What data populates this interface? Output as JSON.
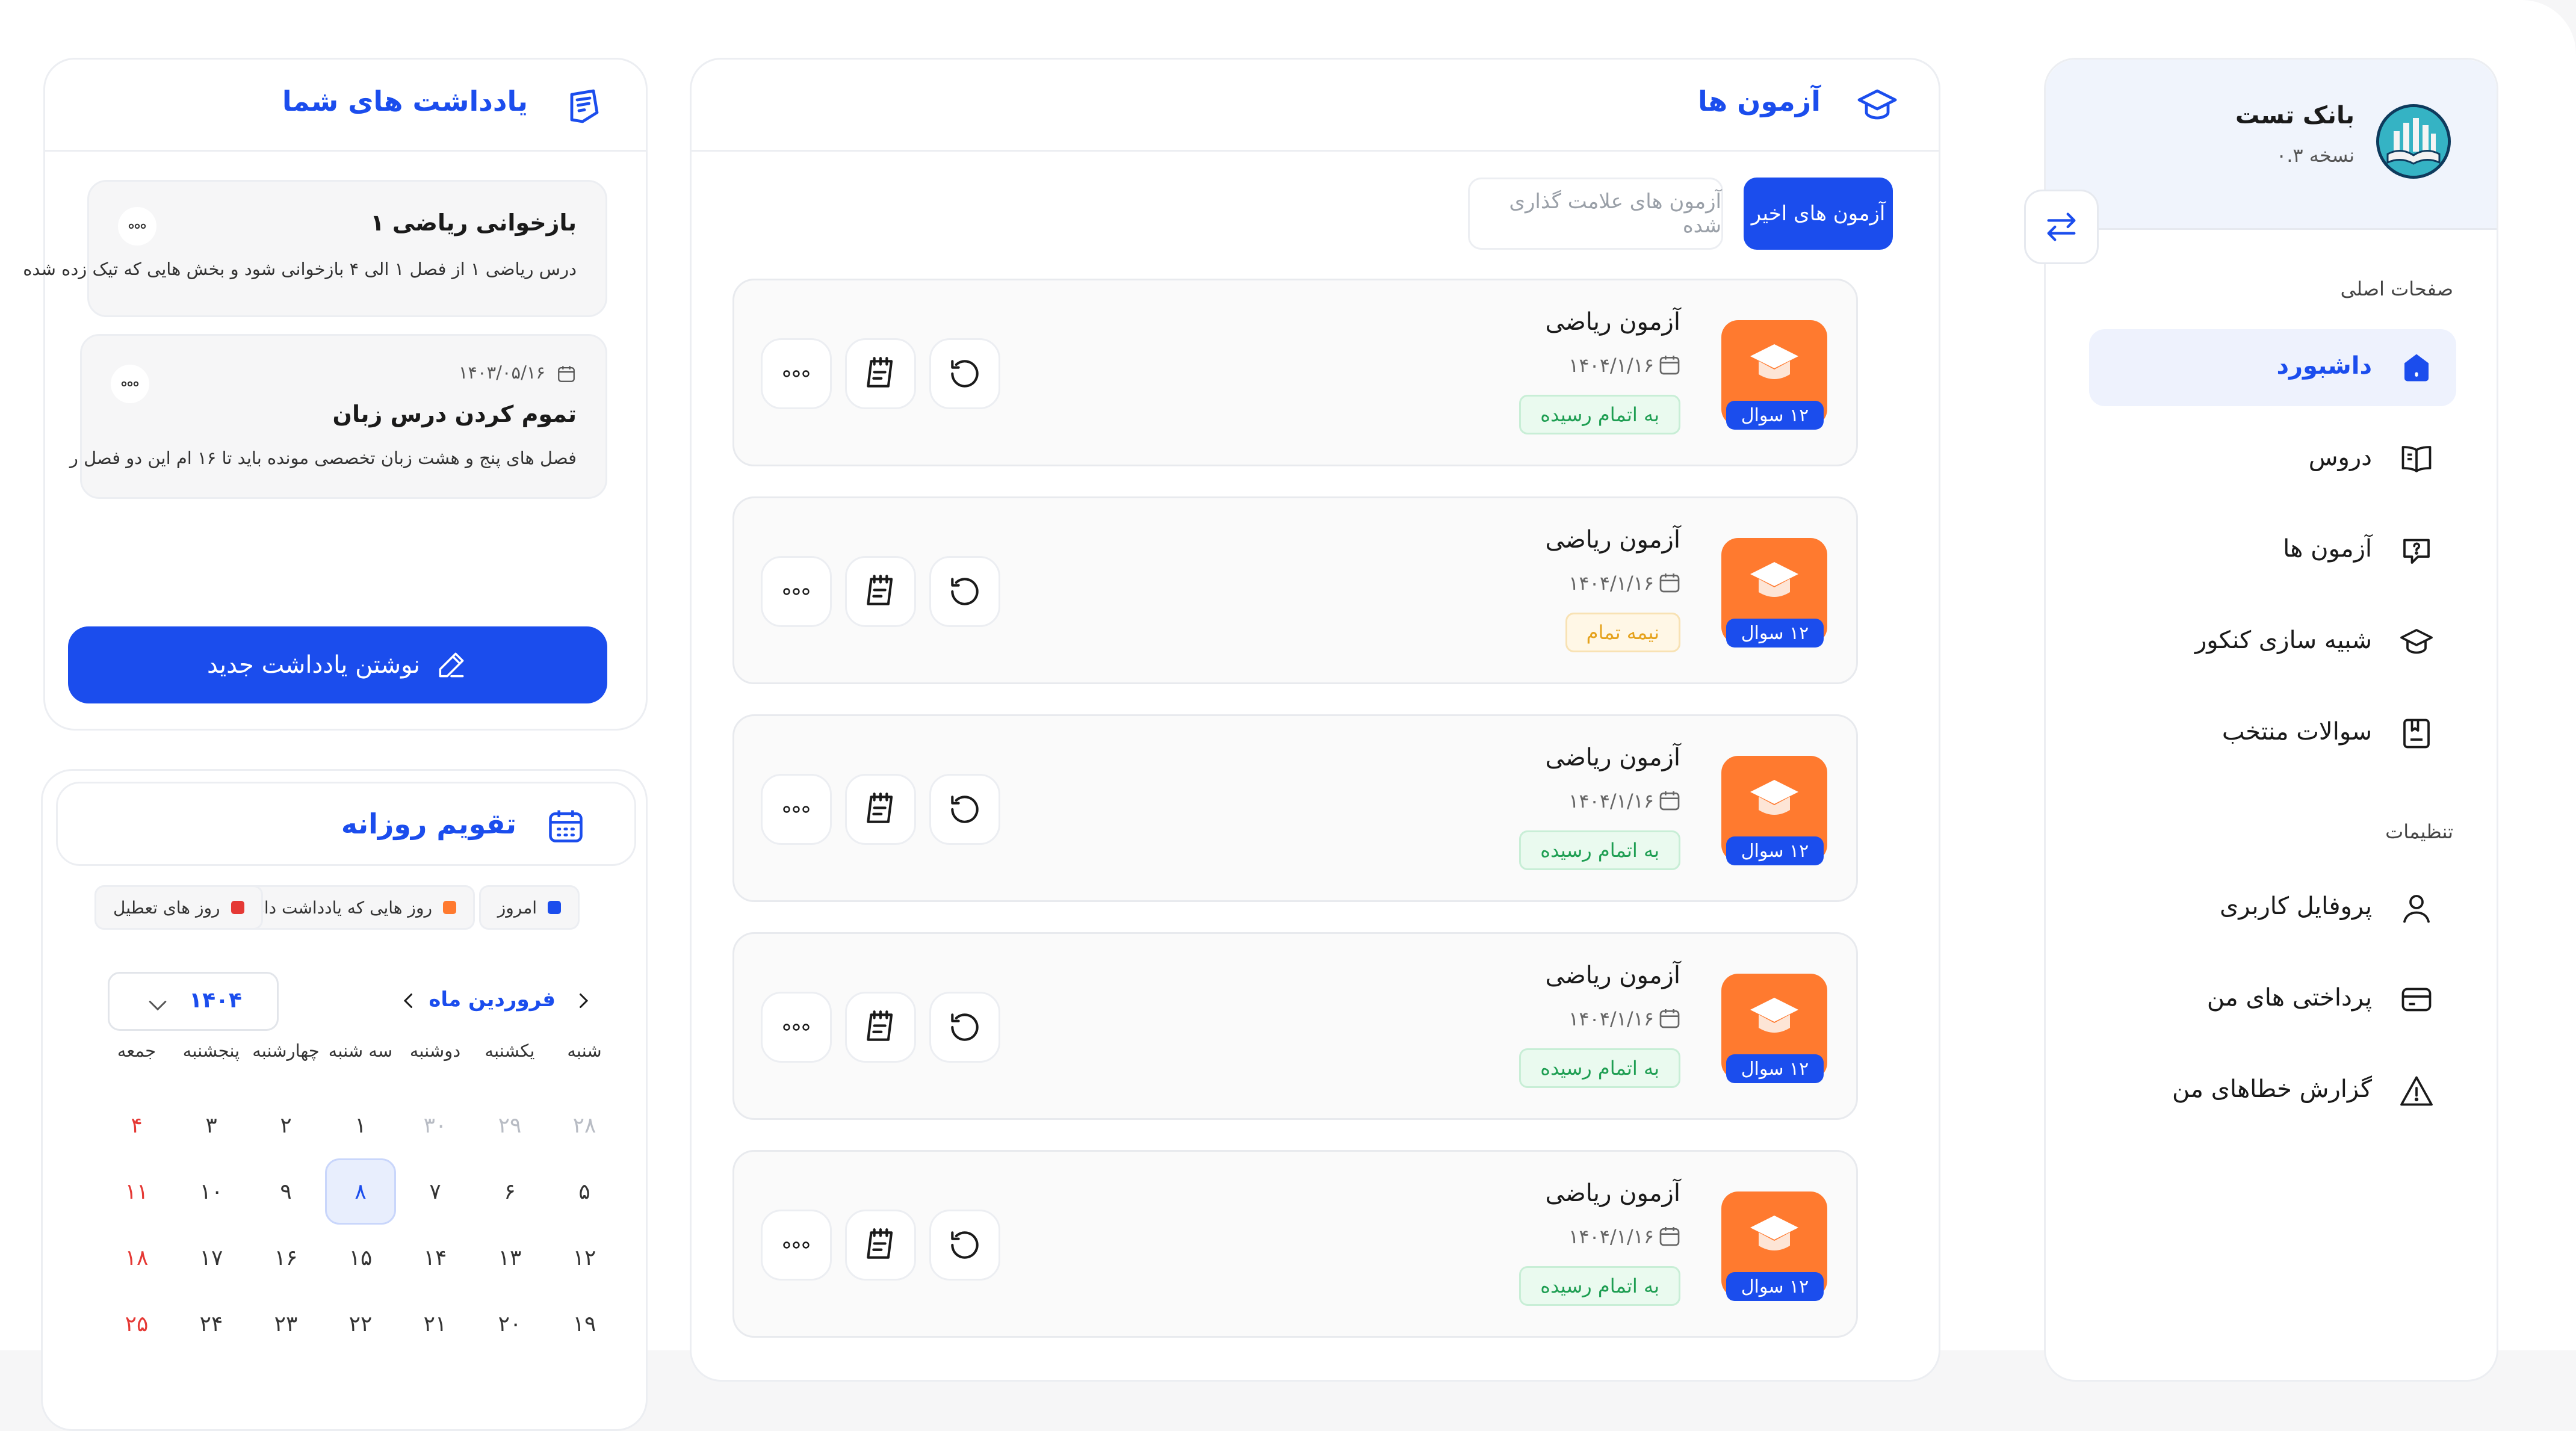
{
  "app": {
    "title": "بانک تست",
    "version": "نسخه ۰.۳"
  },
  "sidebar": {
    "section_main": "صفحات اصلی",
    "section_settings": "تنظیمات",
    "items": [
      {
        "label": "داشبورد",
        "icon": "home-icon"
      },
      {
        "label": "دروس",
        "icon": "book-icon"
      },
      {
        "label": "آزمون ها",
        "icon": "question-chat-icon"
      },
      {
        "label": "شبیه سازی کنکور",
        "icon": "graduation-cap-icon"
      },
      {
        "label": "سوالات منتخب",
        "icon": "bookmark-book-icon"
      }
    ],
    "settings_items": [
      {
        "label": "پروفایل کاربری",
        "icon": "user-icon"
      },
      {
        "label": "پرداختی های من",
        "icon": "card-icon"
      },
      {
        "label": "گزارش خطاهای من",
        "icon": "warning-icon"
      }
    ]
  },
  "exams": {
    "title": "آزمون ها",
    "tab_recent": "آزمون های اخیر",
    "tab_marked": "آزمون های علامت گذاری شده",
    "rows": [
      {
        "name": "آزمون ریاضی",
        "date": "۱۴۰۴/۱/۱۶",
        "questions": "۱۲ سوال",
        "status": "به اتمام رسیده"
      },
      {
        "name": "آزمون ریاضی",
        "date": "۱۴۰۴/۱/۱۶",
        "questions": "۱۲ سوال",
        "status": "نیمه تمام"
      },
      {
        "name": "آزمون ریاضی",
        "date": "۱۴۰۴/۱/۱۶",
        "questions": "۱۲ سوال",
        "status": "به اتمام رسیده"
      },
      {
        "name": "آزمون ریاضی",
        "date": "۱۴۰۴/۱/۱۶",
        "questions": "۱۲ سوال",
        "status": "به اتمام رسیده"
      },
      {
        "name": "آزمون ریاضی",
        "date": "۱۴۰۴/۱/۱۶",
        "questions": "۱۲ سوال",
        "status": "به اتمام رسیده"
      }
    ]
  },
  "notes": {
    "title": "یادداشت های شما",
    "items": [
      {
        "title": "بازخوانی ریاضی ۱",
        "text": "درس ریاضی ۱ از فصل ۱ الی ۴ بازخوانی شود و بخش هایی که تیک زده شده"
      },
      {
        "date": "۱۴۰۳/۰۵/۱۶",
        "title": "تموم کردن درس زبان",
        "text": "فصل های پنج و هشت زبان تخصصی مونده باید تا ۱۶ ام این دو فصل ر"
      }
    ],
    "write_button": "نوشتن یادداشت جدید"
  },
  "calendar": {
    "title": "تقویم روزانه",
    "legend": [
      {
        "label": "امروز",
        "color": "#1b4ded"
      },
      {
        "label": "روز هایی که یادداشت دارن",
        "color": "#ff7a2f"
      },
      {
        "label": "روز های تعطیل",
        "color": "#e53935"
      }
    ],
    "month": "فروردین ماه",
    "year": "۱۴۰۴",
    "weekdays": [
      "شنبه",
      "یکشنبه",
      "دوشنبه",
      "سه شنبه",
      "چهارشنبه",
      "پنجشنبه",
      "جمعه"
    ],
    "weeks": [
      [
        "۲۸",
        "۲۹",
        "۳۰",
        "۱",
        "۲",
        "۳",
        "۴"
      ],
      [
        "۵",
        "۶",
        "۷",
        "۸",
        "۹",
        "۱۰",
        "۱۱"
      ],
      [
        "۱۲",
        "۱۳",
        "۱۴",
        "۱۵",
        "۱۶",
        "۱۷",
        "۱۸"
      ],
      [
        "۱۹",
        "۲۰",
        "۲۱",
        "۲۲",
        "۲۳",
        "۲۴",
        "۲۵"
      ]
    ],
    "today": "۸"
  },
  "colors": {
    "accent": "#1b4ded",
    "orange": "#ff7a2f",
    "holiday": "#e53935",
    "done": "#1e9e52",
    "half": "#e5a21c"
  }
}
